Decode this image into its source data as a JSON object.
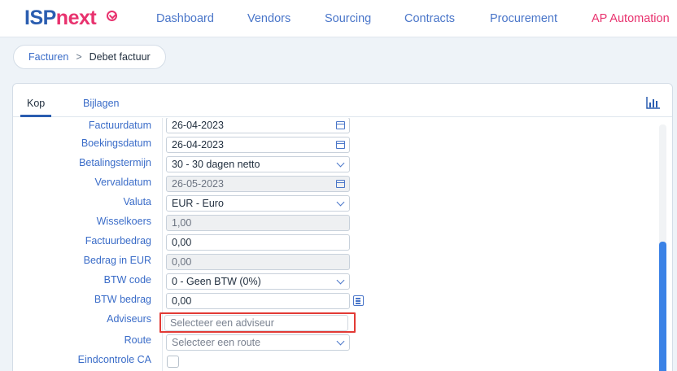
{
  "app": {
    "logo_part1": "ISP",
    "logo_part2": "next"
  },
  "nav": {
    "items": [
      {
        "label": "Dashboard"
      },
      {
        "label": "Vendors"
      },
      {
        "label": "Sourcing"
      },
      {
        "label": "Contracts"
      },
      {
        "label": "Procurement"
      },
      {
        "label": "AP Automation"
      }
    ]
  },
  "breadcrumb": {
    "parent": "Facturen",
    "separator": ">",
    "current": "Debet factuur"
  },
  "tabs": {
    "kop": "Kop",
    "bijlagen": "Bijlagen"
  },
  "form": {
    "factuurdatum": {
      "label": "Factuurdatum",
      "value": "26-04-2023"
    },
    "boekingsdatum": {
      "label": "Boekingsdatum",
      "value": "26-04-2023"
    },
    "betalingstermijn": {
      "label": "Betalingstermijn",
      "value": "30 - 30 dagen netto"
    },
    "vervaldatum": {
      "label": "Vervaldatum",
      "value": "26-05-2023"
    },
    "valuta": {
      "label": "Valuta",
      "value": "EUR - Euro"
    },
    "wisselkoers": {
      "label": "Wisselkoers",
      "value": "1,00"
    },
    "factuurbedrag": {
      "label": "Factuurbedrag",
      "value": "0,00"
    },
    "bedrag_eur": {
      "label": "Bedrag in EUR",
      "value": "0,00"
    },
    "btw_code": {
      "label": "BTW code",
      "value": "0 - Geen BTW (0%)"
    },
    "btw_bedrag": {
      "label": "BTW bedrag",
      "value": "0,00"
    },
    "adviseurs": {
      "label": "Adviseurs",
      "placeholder": "Selecteer een adviseur"
    },
    "route": {
      "label": "Route",
      "placeholder": "Selecteer een route"
    },
    "eindcontrole": {
      "label": "Eindcontrole CA"
    }
  },
  "icons": {
    "logo_mark": "check-circle-icon",
    "chart": "bar-chart-icon",
    "calendar": "calendar-icon",
    "dropdown": "chevron-down-icon",
    "calculator": "calculator-icon"
  },
  "colors": {
    "brand_blue": "#2a5db0",
    "brand_pink": "#e8326e",
    "link_blue": "#3a6cc8",
    "highlight_red": "#e23a35",
    "scroll_thumb": "#3b82e6"
  }
}
